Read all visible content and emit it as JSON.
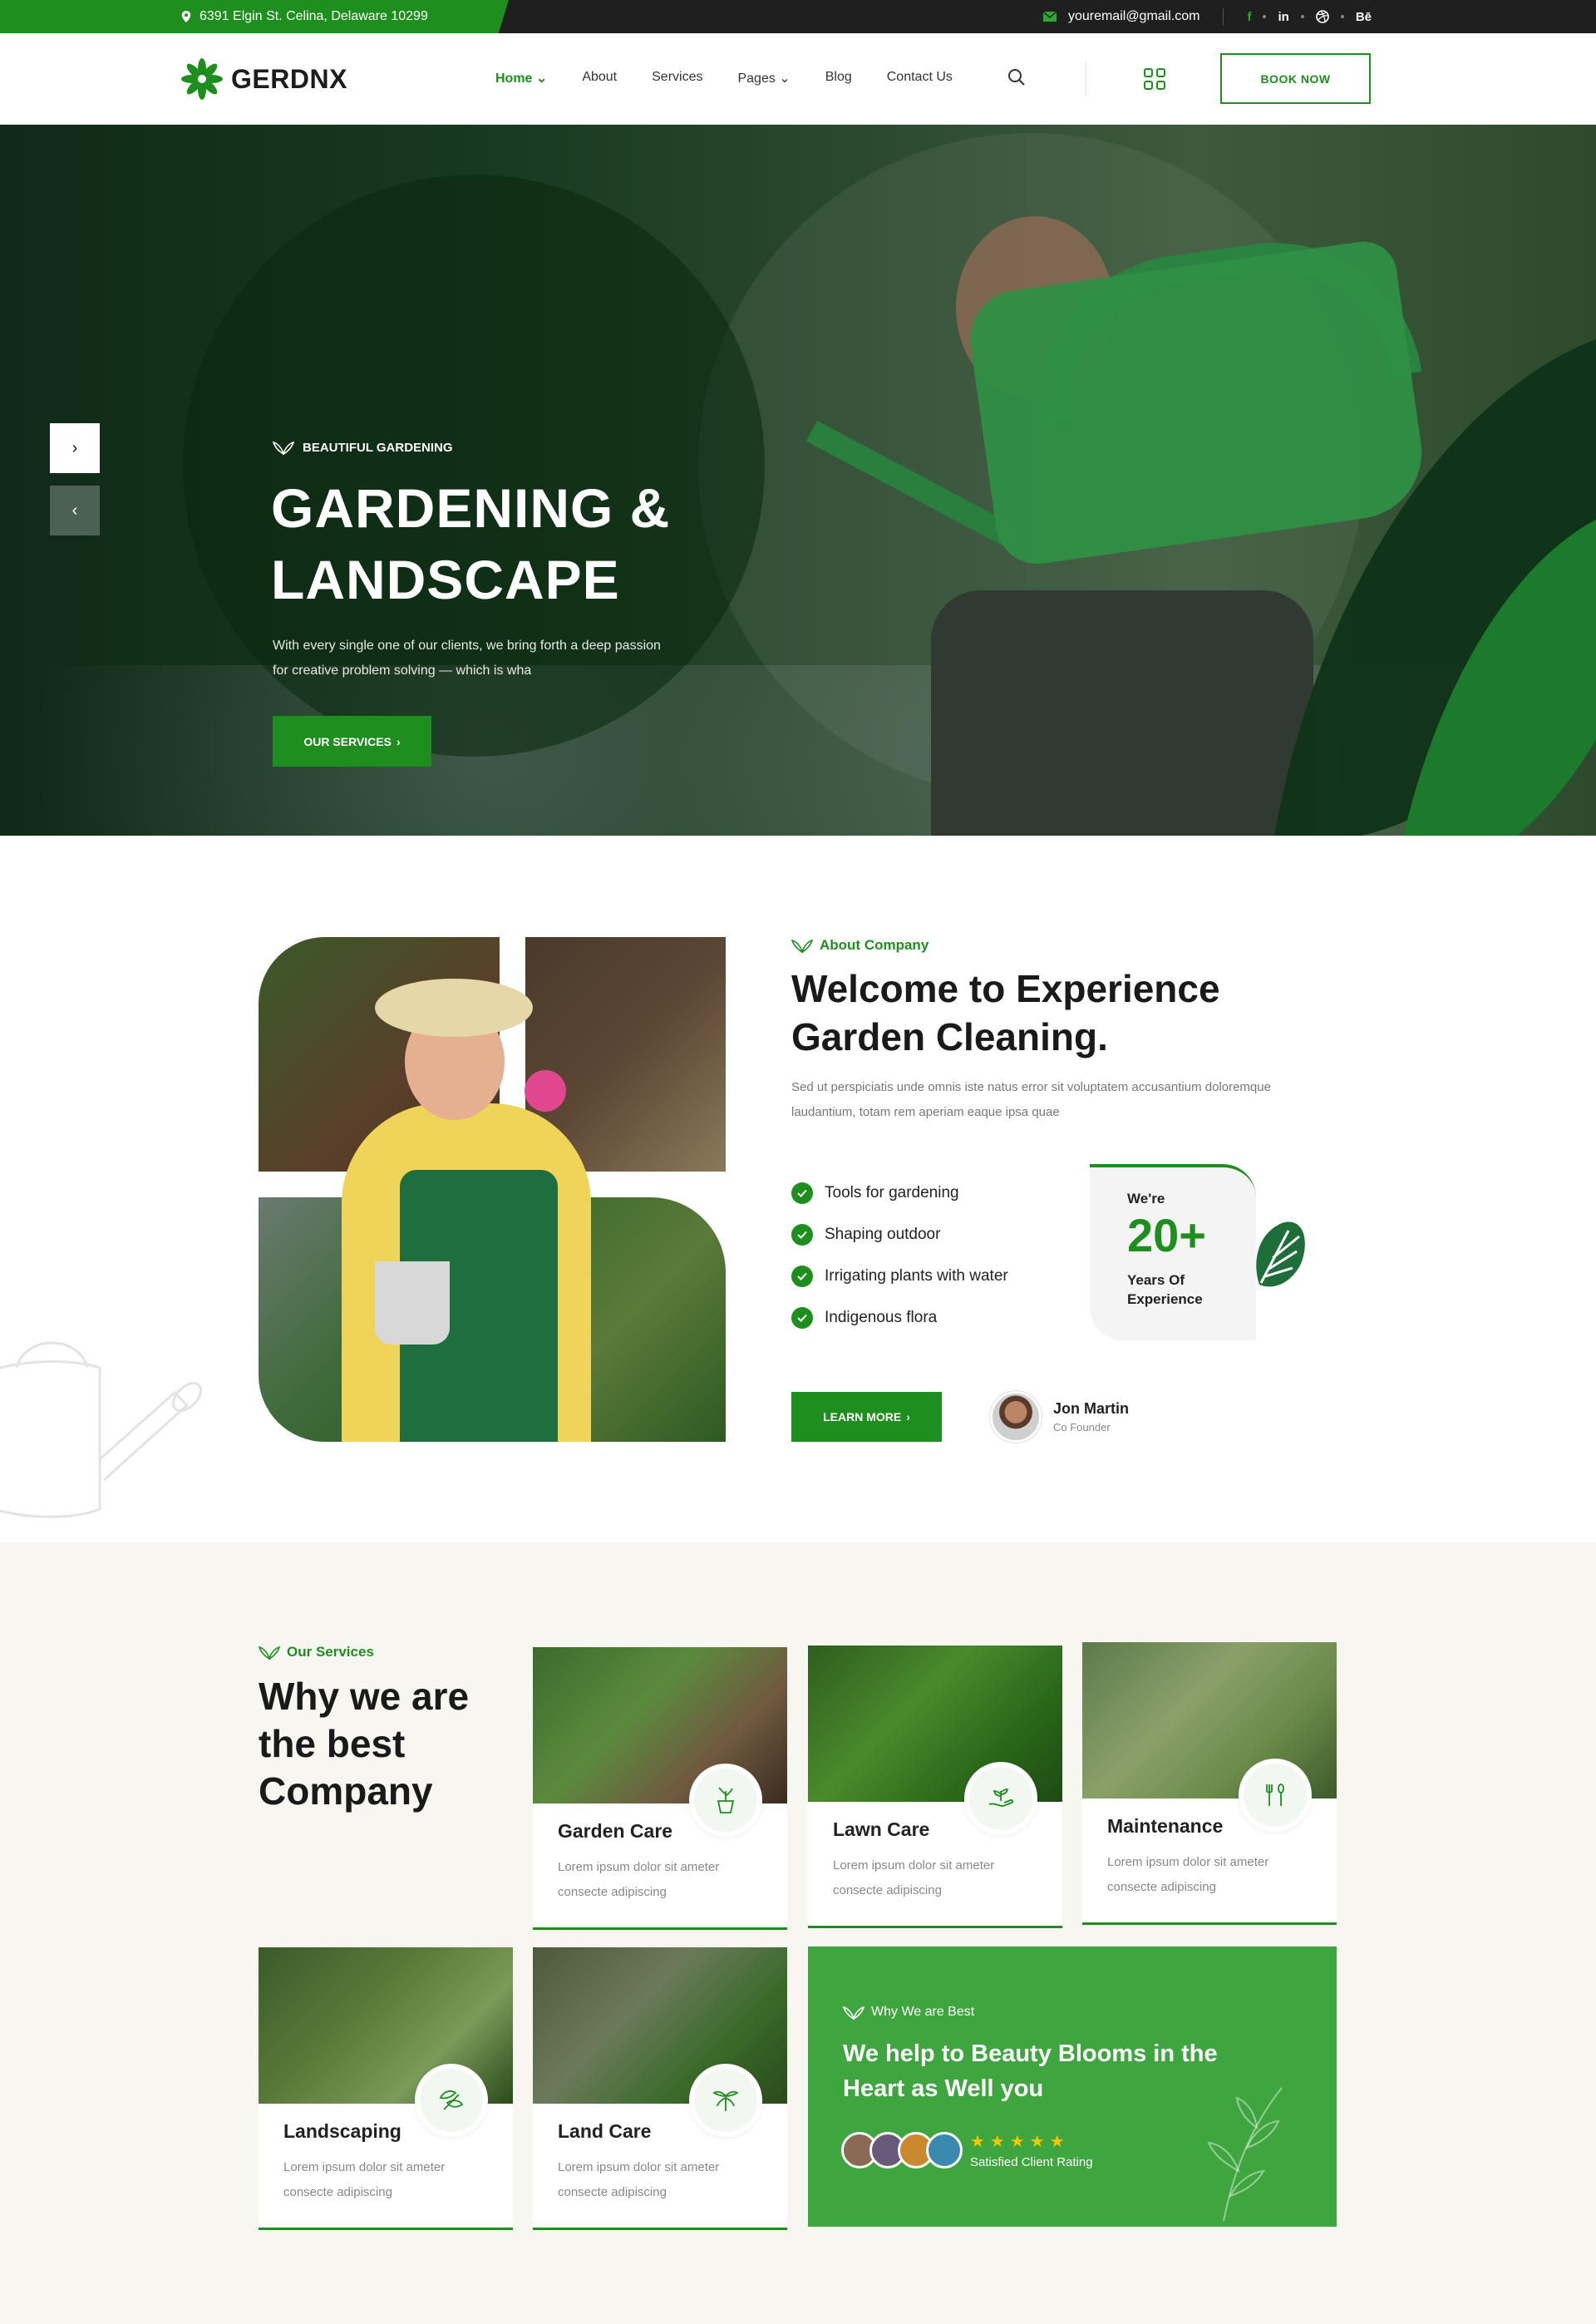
{
  "topbar": {
    "address": "6391 Elgin St. Celina, Delaware 10299",
    "email": "youremail@gmail.com",
    "social": [
      "f",
      "in",
      "dribbble",
      "Bē"
    ]
  },
  "header": {
    "logo_text": "GERDNX",
    "nav": [
      "Home",
      "About",
      "Services",
      "Pages",
      "Blog",
      "Contact Us"
    ],
    "book_button": "BOOK NOW"
  },
  "hero": {
    "tag": "BEAUTIFUL GARDENING",
    "title_line1": "GARDENING &",
    "title_line2": "LANDSCAPE",
    "description": "With every single one of our clients, we bring forth a deep passion for creative problem solving — which is wha",
    "button": "OUR SERVICES"
  },
  "about": {
    "tag": "About Company",
    "title": "Welcome to Experience Garden Cleaning.",
    "description": "Sed ut perspiciatis unde omnis iste natus error sit voluptatem accusantium doloremque laudantium, totam rem aperiam eaque ipsa quae",
    "checklist": [
      "Tools for gardening",
      "Shaping outdoor",
      "Irrigating plants with water",
      "Indigenous flora"
    ],
    "experience": {
      "prefix": "We're",
      "number": "20+",
      "label": "Years Of Experience"
    },
    "button": "LEARN MORE",
    "author": {
      "name": "Jon Martin",
      "role": "Co Founder"
    }
  },
  "services": {
    "tag": "Our Services",
    "title": "Why we are the best Company",
    "cards": [
      {
        "title": "Garden Care",
        "desc": "Lorem ipsum dolor sit ameter consecte adipiscing"
      },
      {
        "title": "Lawn Care",
        "desc": "Lorem ipsum dolor sit ameter consecte adipiscing"
      },
      {
        "title": "Maintenance",
        "desc": "Lorem ipsum dolor sit ameter consecte adipiscing"
      },
      {
        "title": "Landscaping",
        "desc": "Lorem ipsum dolor sit ameter consecte adipiscing"
      },
      {
        "title": "Land Care",
        "desc": "Lorem ipsum dolor sit ameter consecte adipiscing"
      }
    ],
    "blooms": {
      "tag": "Why We are Best",
      "title": "We help to Beauty Blooms in the Heart as Well you",
      "stars": "★★★★★",
      "rating_label": "Satisfied Client Rating"
    }
  },
  "colors": {
    "brand_green": "#1e8f1e",
    "light_green": "#3fa63f",
    "dark": "#1f1f1f"
  }
}
